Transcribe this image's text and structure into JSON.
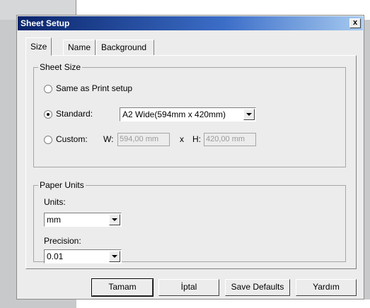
{
  "dialog": {
    "title": "Sheet Setup",
    "close_label": "x"
  },
  "tabs": [
    {
      "label": "Size",
      "active": true
    },
    {
      "label": "Name",
      "active": false
    },
    {
      "label": "Background",
      "active": false
    }
  ],
  "sheet_size": {
    "group_label": "Sheet Size",
    "same_as_print_label": "Same as Print setup",
    "standard_label": "Standard:",
    "standard_value": "A2 Wide(594mm x 420mm)",
    "custom_label": "Custom:",
    "width_label": "W:",
    "width_value": "594,00 mm",
    "x_label": "x",
    "height_label": "H:",
    "height_value": "420,00 mm",
    "selected": "standard"
  },
  "paper_units": {
    "group_label": "Paper Units",
    "units_label": "Units:",
    "units_value": "mm",
    "precision_label": "Precision:",
    "precision_value": "0.01"
  },
  "buttons": {
    "ok": "Tamam",
    "cancel": "İptal",
    "save_defaults": "Save Defaults",
    "help": "Yardım"
  }
}
